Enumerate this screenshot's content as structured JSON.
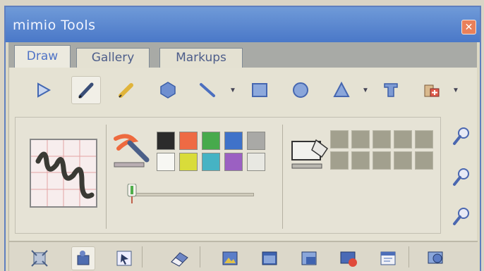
{
  "window": {
    "title": "mimio Tools"
  },
  "tabs": [
    {
      "label": "Draw"
    },
    {
      "label": "Gallery"
    },
    {
      "label": "Markups"
    }
  ],
  "colors": {
    "palette": [
      "#2b2b2b",
      "#ee6a44",
      "#47aa4c",
      "#3f72c9",
      "#a9a9a6",
      "#f7f7f3",
      "#d9dc3a",
      "#46b3c4",
      "#9b60c2",
      "#e8e8e2"
    ]
  },
  "toolbar": {
    "tools": [
      "select-icon",
      "pen-icon",
      "highlighter-icon",
      "shape-icon",
      "line-icon",
      "rectangle-icon",
      "circle-icon",
      "triangle-icon",
      "text-icon",
      "insert-icon"
    ]
  },
  "bottom_toolbar": {
    "tools": [
      "fit-icon",
      "stamp-icon",
      "select-window-icon",
      "eraser-icon",
      "image-icon",
      "screen-icon",
      "windowed-icon",
      "record-icon",
      "calendar-icon",
      "capture-icon"
    ]
  }
}
